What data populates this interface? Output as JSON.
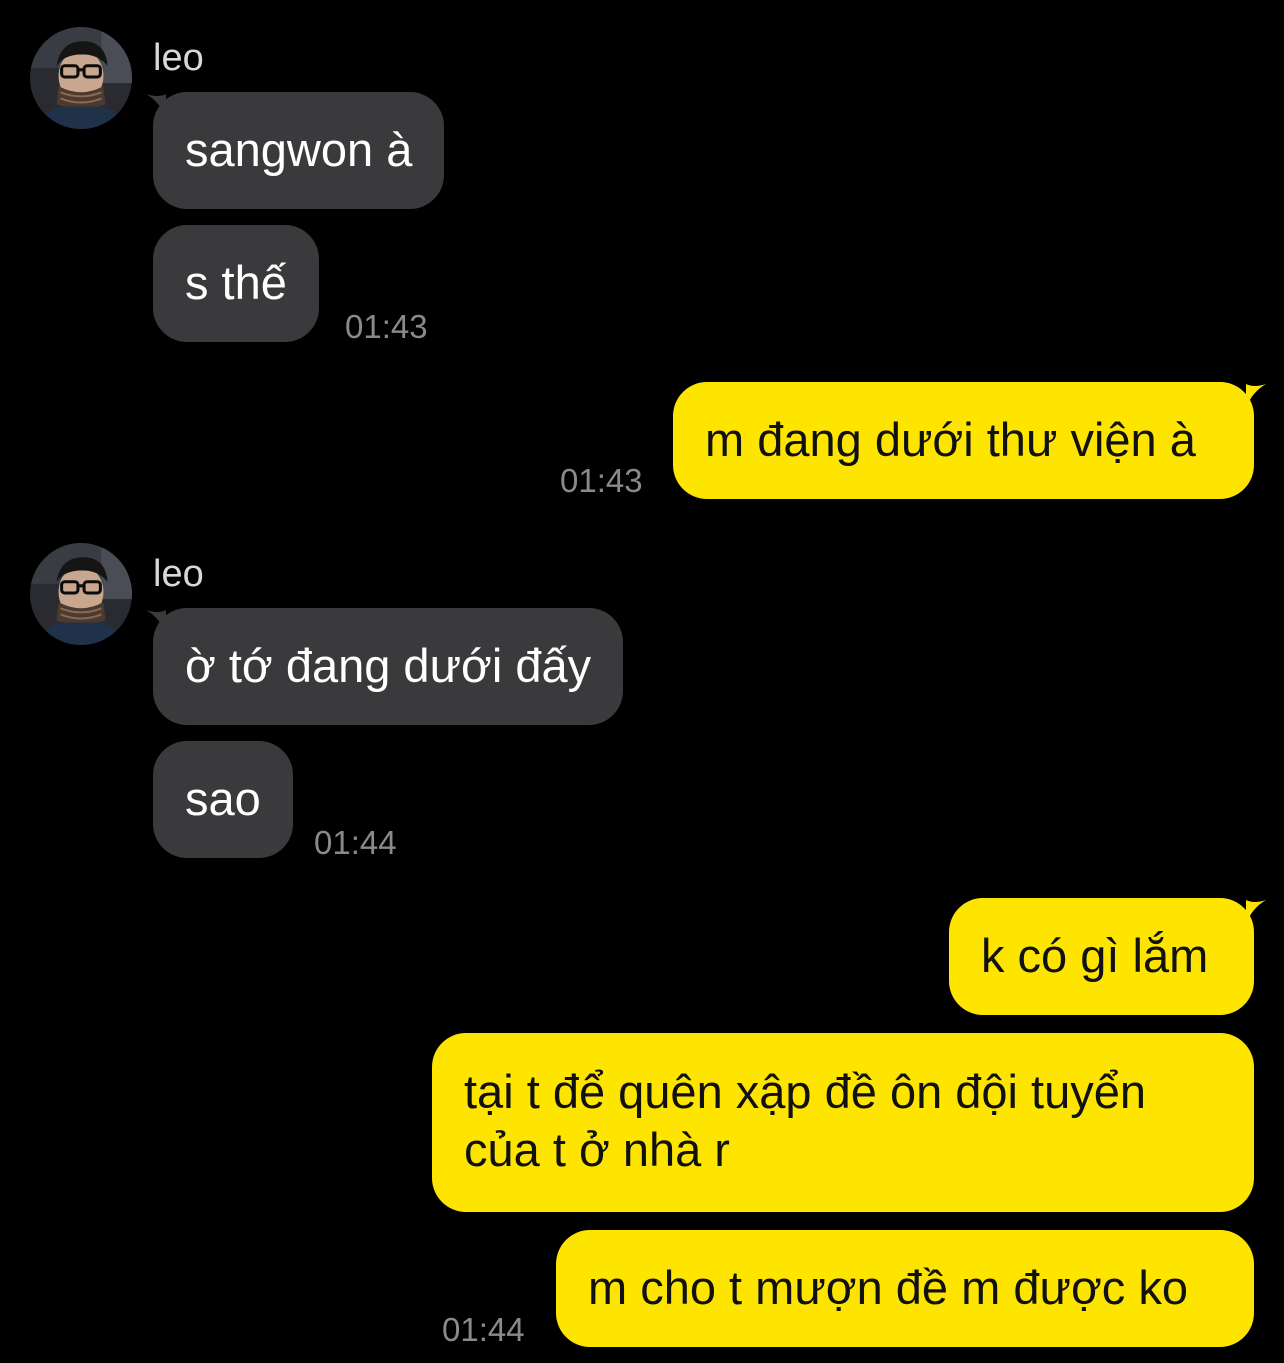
{
  "colors": {
    "background": "#000000",
    "incoming_bubble": "#3a3a3c",
    "outgoing_bubble": "#fee500",
    "timestamp": "#8a8a8e"
  },
  "group1": {
    "sender": "leo",
    "avatar": "profile-photo",
    "messages": [
      "sangwon à",
      "s thế"
    ],
    "time": "01:43"
  },
  "reply1": {
    "messages": [
      "m đang dưới thư viện à"
    ],
    "time": "01:43"
  },
  "group2": {
    "sender": "leo",
    "avatar": "profile-photo",
    "messages": [
      "ờ tớ đang dưới đấy",
      "sao"
    ],
    "time": "01:44"
  },
  "reply2": {
    "messages": [
      "k có gì lắm",
      "tại t để quên xập đề ôn đội tuyển của t ở nhà r",
      "m cho t mượn đề m được ko"
    ],
    "time": "01:44"
  }
}
